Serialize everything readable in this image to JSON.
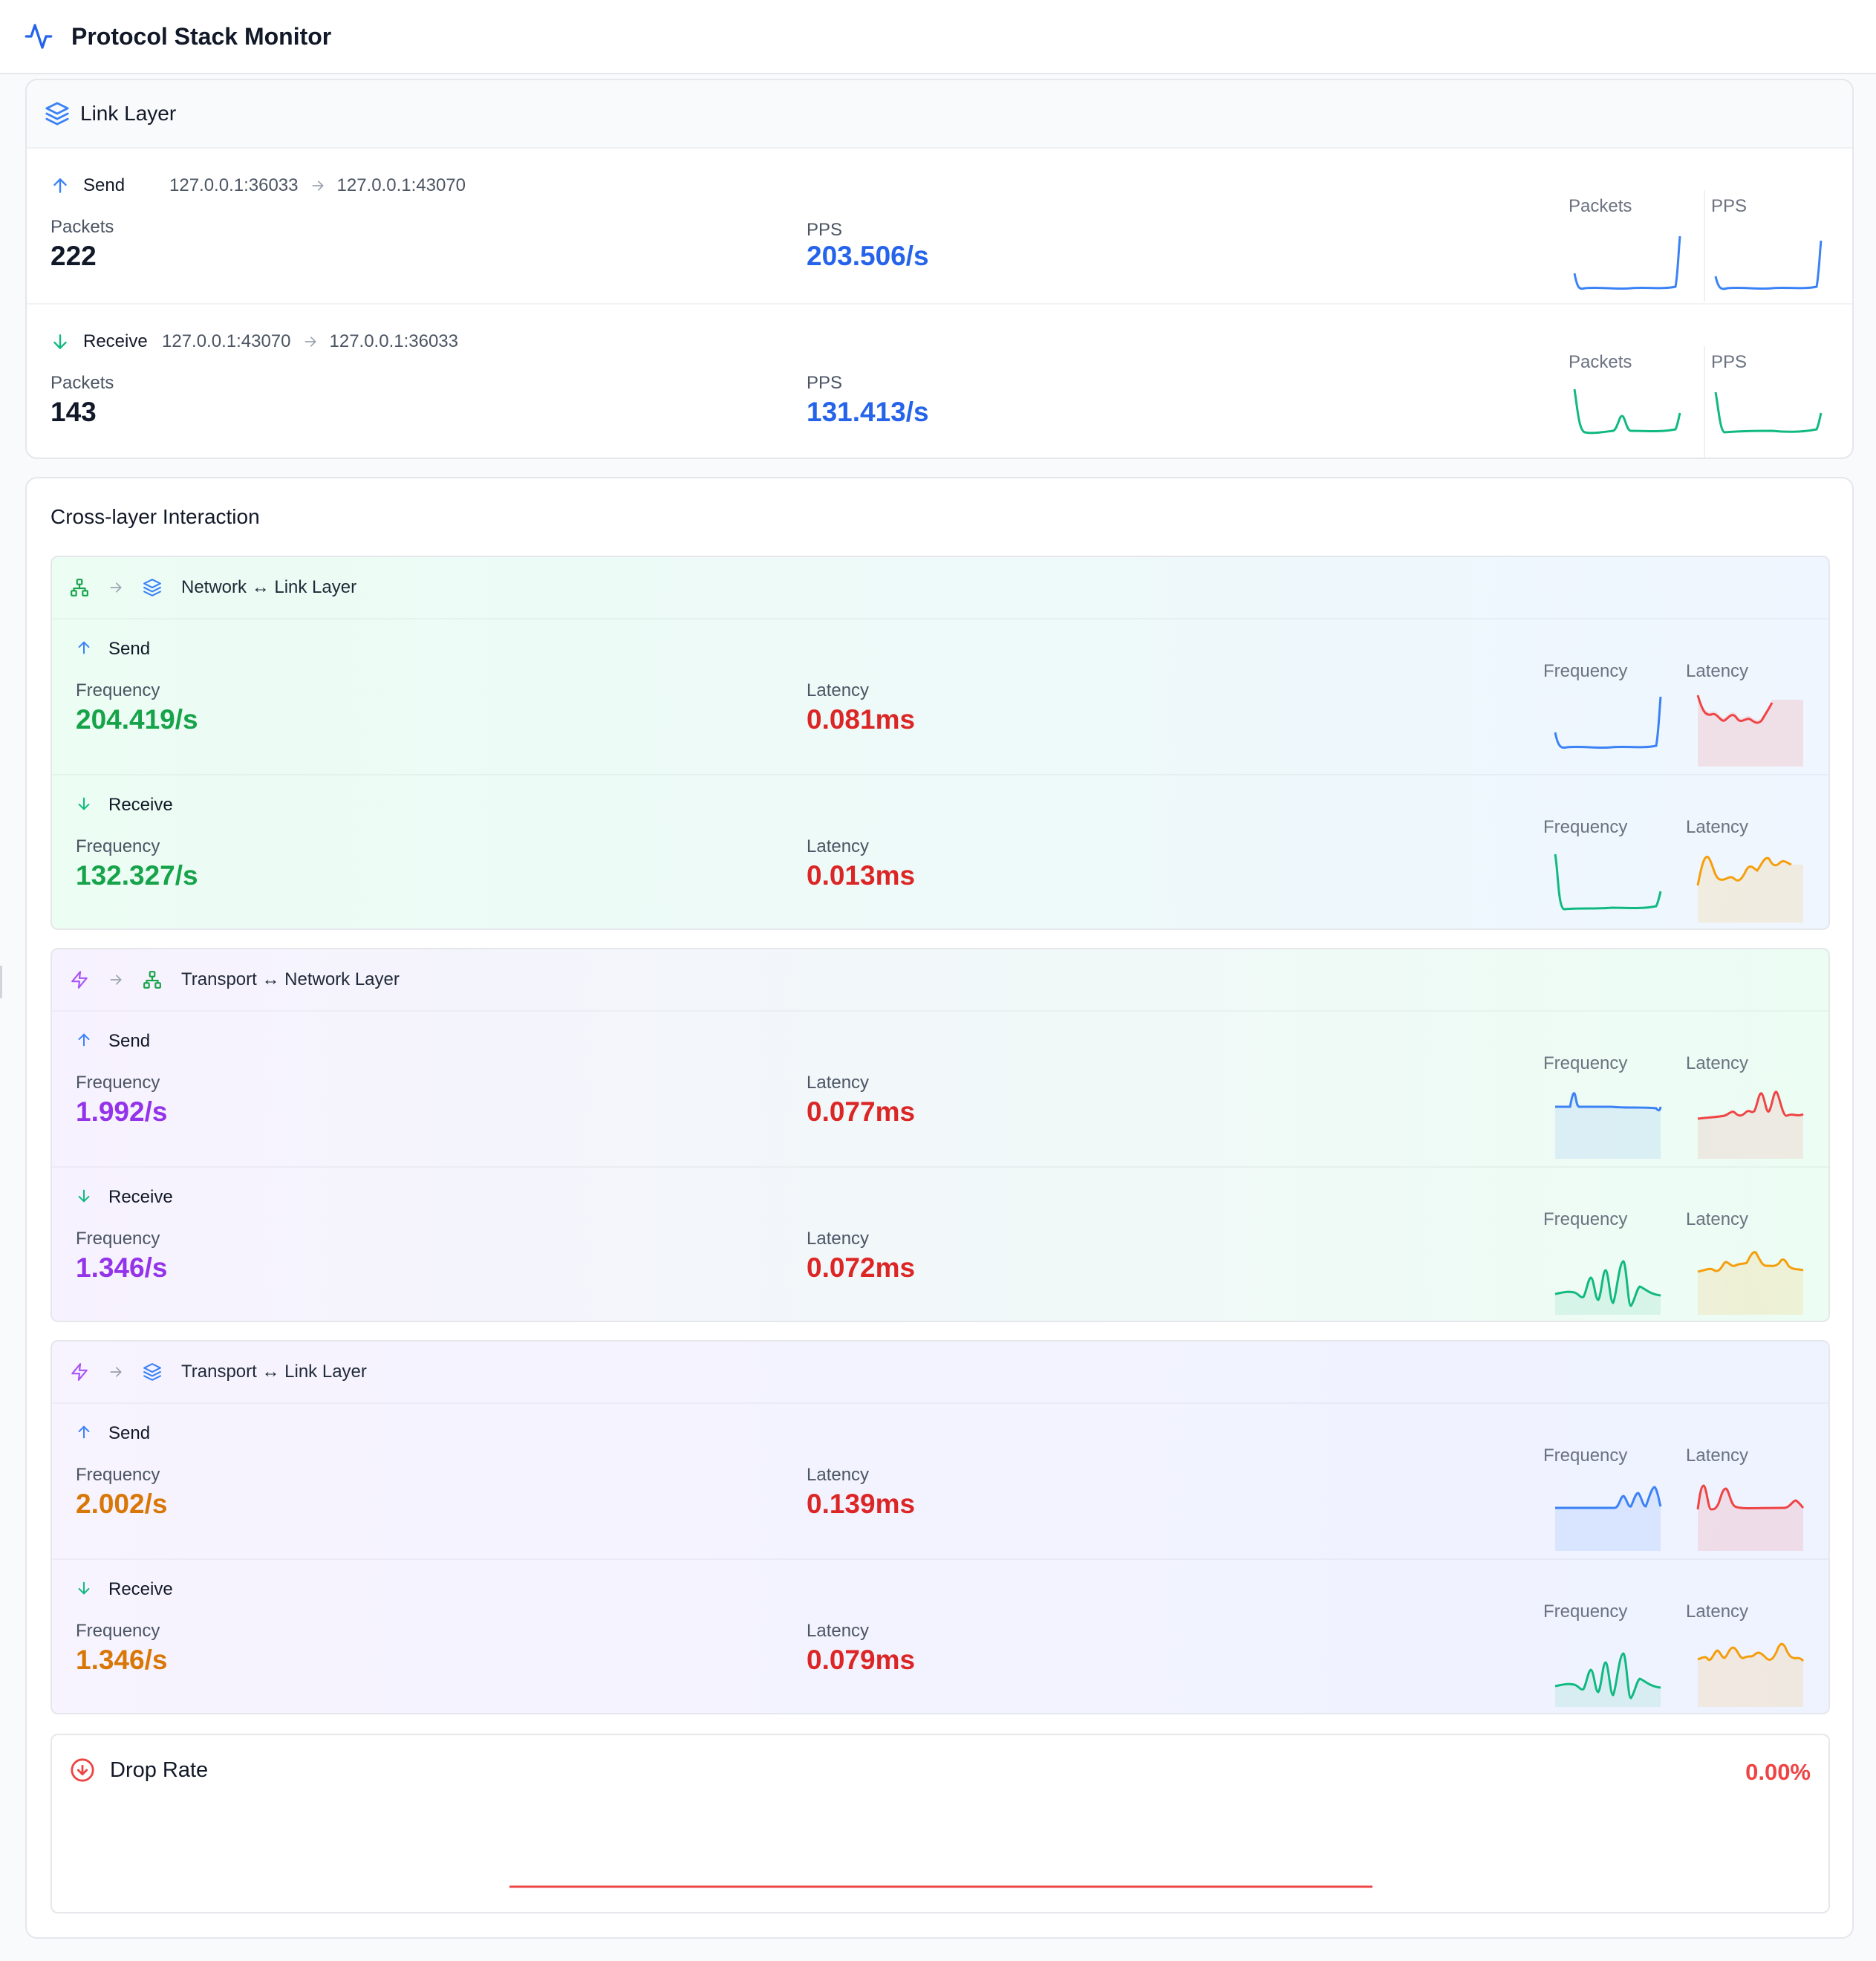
{
  "app": {
    "title": "Protocol Stack Monitor"
  },
  "colors": {
    "blue": "#3b82f6",
    "green": "#10b981",
    "red": "#ef4444",
    "orange": "#f59e0b",
    "purple": "#9333ea",
    "dark_orange": "#d97706",
    "dark_green": "#16a34a",
    "dark_red": "#dc2626",
    "dark_blue": "#2563eb"
  },
  "link_layer": {
    "title": "Link Layer",
    "icon": "layers-icon",
    "send": {
      "label": "Send",
      "src": "127.0.0.1:36033",
      "dst": "127.0.0.1:43070",
      "packets_label": "Packets",
      "packets": "222",
      "pps_label": "PPS",
      "pps": "203.506/s",
      "spark_packets_label": "Packets",
      "spark_pps_label": "PPS"
    },
    "receive": {
      "label": "Receive",
      "src": "127.0.0.1:43070",
      "dst": "127.0.0.1:36033",
      "packets_label": "Packets",
      "packets": "143",
      "pps_label": "PPS",
      "pps": "131.413/s",
      "spark_packets_label": "Packets",
      "spark_pps_label": "PPS"
    }
  },
  "cross_layer": {
    "title": "Cross-layer Interaction",
    "panels": [
      {
        "title": "Network ↔ Link Layer",
        "from_icon": "network-icon",
        "to_icon": "layers-icon",
        "send": {
          "label": "Send",
          "freq_label": "Frequency",
          "freq": "204.419/s",
          "lat_label": "Latency",
          "lat": "0.081ms",
          "spark_freq_label": "Frequency",
          "spark_lat_label": "Latency"
        },
        "receive": {
          "label": "Receive",
          "freq_label": "Frequency",
          "freq": "132.327/s",
          "lat_label": "Latency",
          "lat": "0.013ms",
          "spark_freq_label": "Frequency",
          "spark_lat_label": "Latency"
        }
      },
      {
        "title": "Transport ↔ Network Layer",
        "from_icon": "lightning-icon",
        "to_icon": "network-icon",
        "send": {
          "label": "Send",
          "freq_label": "Frequency",
          "freq": "1.992/s",
          "lat_label": "Latency",
          "lat": "0.077ms",
          "spark_freq_label": "Frequency",
          "spark_lat_label": "Latency"
        },
        "receive": {
          "label": "Receive",
          "freq_label": "Frequency",
          "freq": "1.346/s",
          "lat_label": "Latency",
          "lat": "0.072ms",
          "spark_freq_label": "Frequency",
          "spark_lat_label": "Latency"
        }
      },
      {
        "title": "Transport ↔ Link Layer",
        "from_icon": "lightning-icon",
        "to_icon": "layers-icon",
        "send": {
          "label": "Send",
          "freq_label": "Frequency",
          "freq": "2.002/s",
          "lat_label": "Latency",
          "lat": "0.139ms",
          "spark_freq_label": "Frequency",
          "spark_lat_label": "Latency"
        },
        "receive": {
          "label": "Receive",
          "freq_label": "Frequency",
          "freq": "1.346/s",
          "lat_label": "Latency",
          "lat": "0.079ms",
          "spark_freq_label": "Frequency",
          "spark_lat_label": "Latency"
        }
      }
    ]
  },
  "drop_rate": {
    "title": "Drop Rate",
    "value": "0.00%",
    "icon": "arrow-down-circle-icon"
  }
}
